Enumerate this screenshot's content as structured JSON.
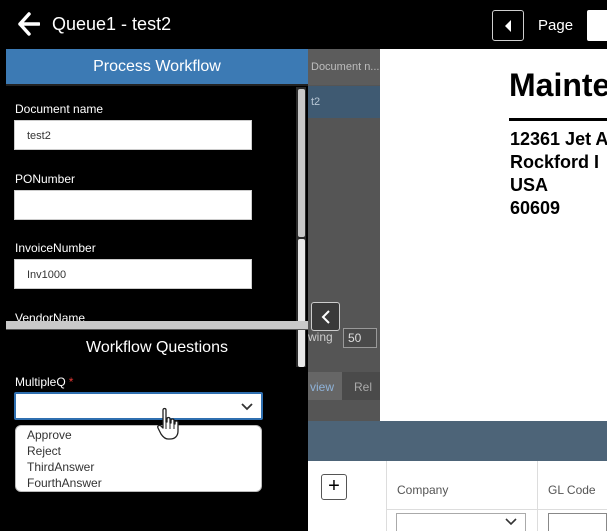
{
  "header": {
    "title": "Queue1 - test2",
    "page_label": "Page"
  },
  "panel": {
    "title": "Process Workflow",
    "fields": [
      {
        "label": "Document name",
        "value": "test2"
      },
      {
        "label": "PONumber",
        "value": ""
      },
      {
        "label": "InvoiceNumber",
        "value": "Inv1000"
      },
      {
        "label": "VendorName",
        "value": ""
      }
    ],
    "workflow_questions_title": "Workflow Questions",
    "multiple_q": {
      "label": "MultipleQ",
      "required_mark": "*",
      "selected": "",
      "options": [
        "Approve",
        "Reject",
        "ThirdAnswer",
        "FourthAnswer"
      ]
    }
  },
  "background": {
    "column_header": "Document n...",
    "selected_row": "t2",
    "showing_label": "wing",
    "showing_value": "50",
    "tab_1": "view",
    "tab_2": "Rel"
  },
  "document": {
    "title": "Mainte",
    "lines": [
      "12361 Jet A",
      "Rockford I",
      "USA",
      "60609"
    ]
  },
  "grid": {
    "add_label": "+",
    "columns": [
      "Company",
      "GL Code"
    ]
  },
  "colors": {
    "panel_header": "#3c7ab4",
    "focus_border": "#2f6fb0",
    "required_star": "#e53935",
    "grid_band": "#4d6478"
  }
}
